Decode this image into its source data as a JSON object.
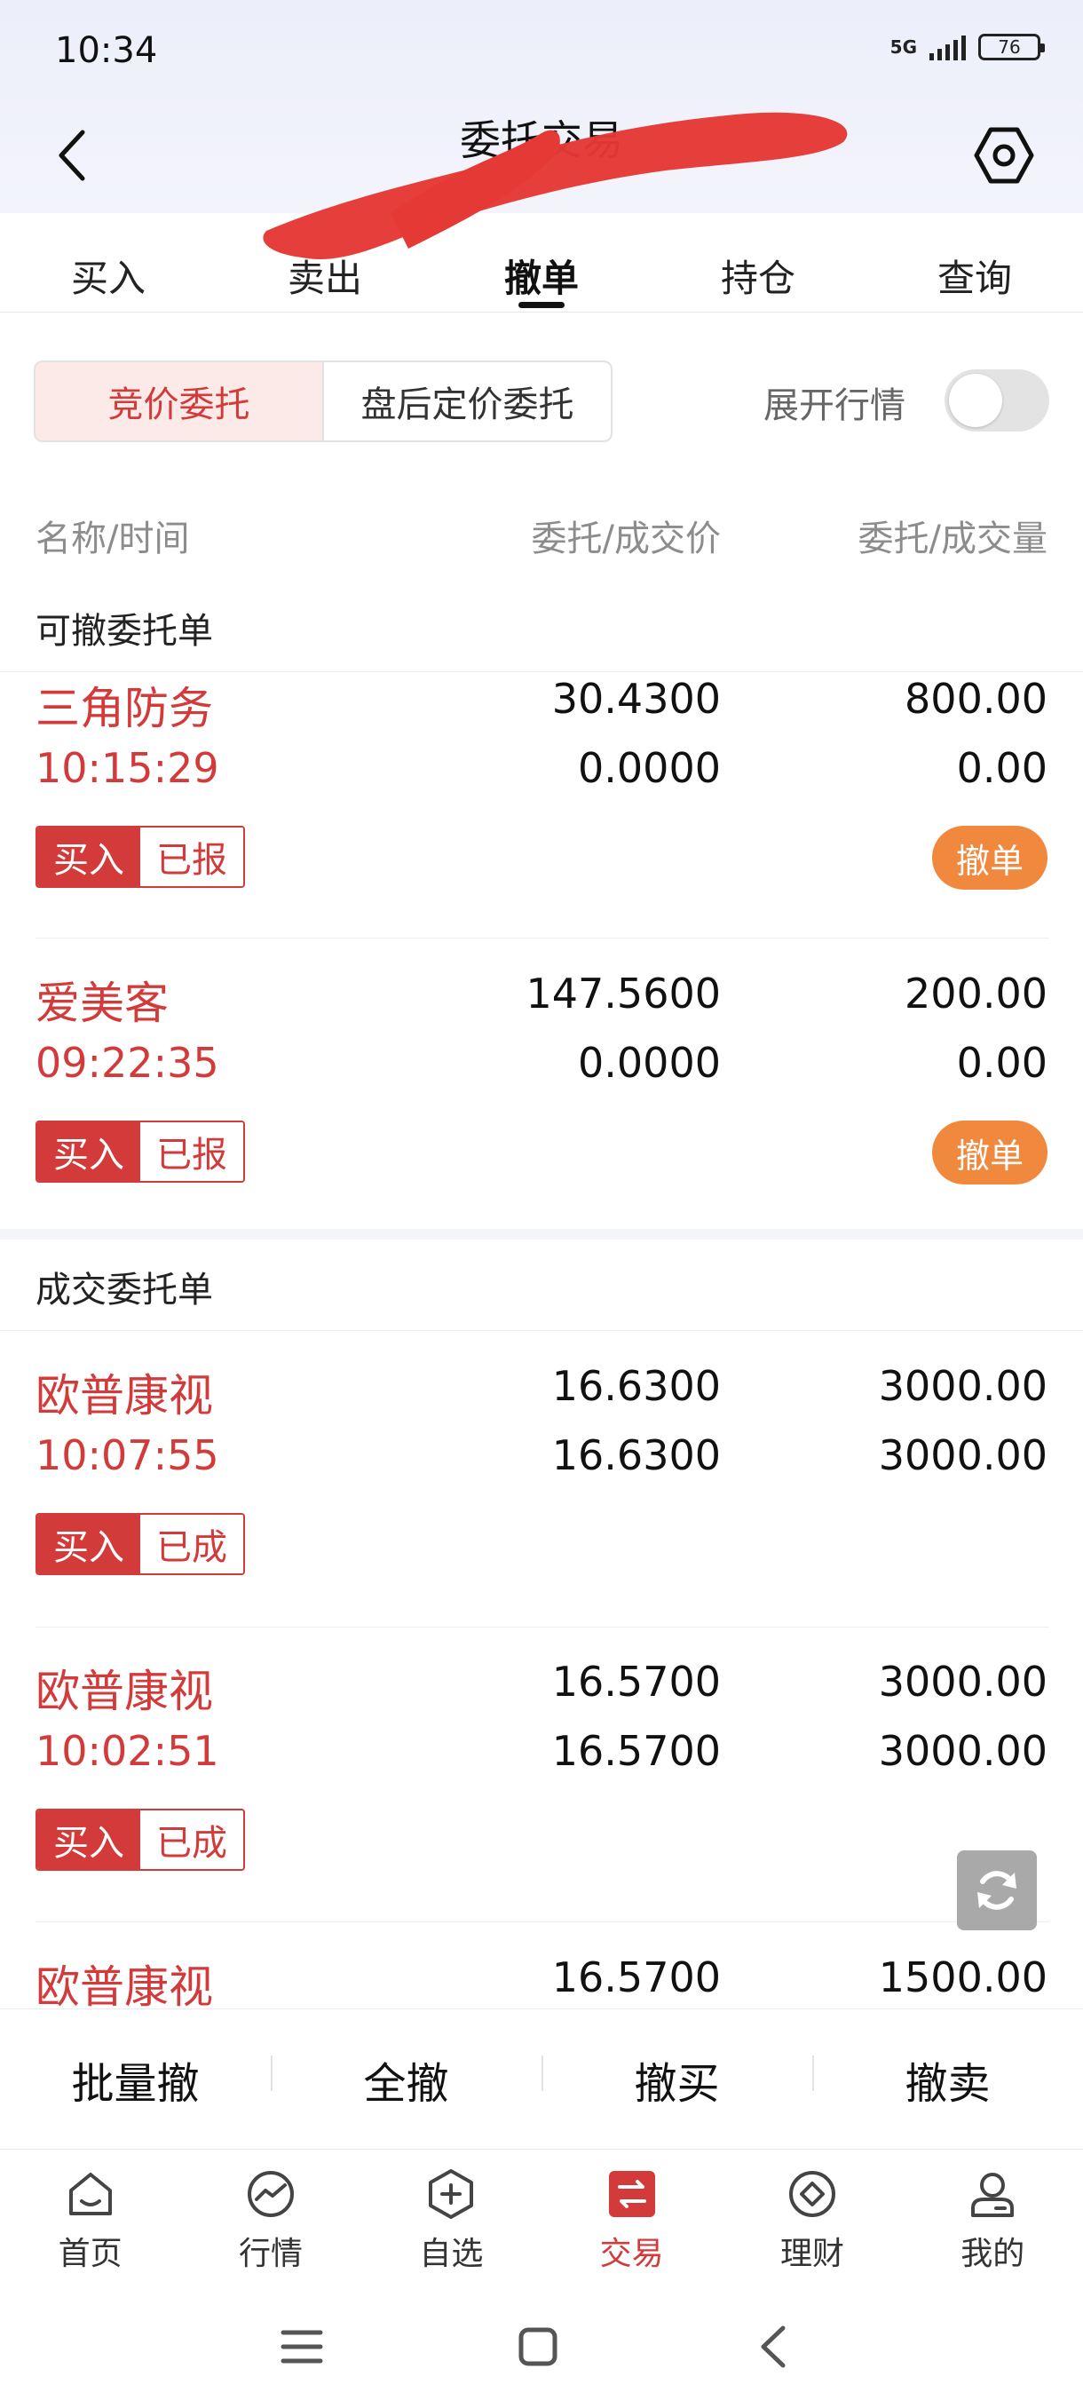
{
  "status_bar": {
    "time": "10:34",
    "network": "5G",
    "battery": "76"
  },
  "header": {
    "title": "委托交易",
    "back_icon": "chevron-left-icon",
    "settings_icon": "settings-hexagon-icon"
  },
  "tabs": [
    {
      "label": "买入"
    },
    {
      "label": "卖出"
    },
    {
      "label": "撤单",
      "active": true
    },
    {
      "label": "持仓"
    },
    {
      "label": "查询"
    }
  ],
  "segments": {
    "active": "竞价委托",
    "other": "盘后定价委托"
  },
  "expand_quote": {
    "label": "展开行情",
    "on": false
  },
  "columns": {
    "name_time": "名称/时间",
    "price": "委托/成交价",
    "volume": "委托/成交量"
  },
  "sections": {
    "cancelable": "可撤委托单",
    "filled": "成交委托单"
  },
  "cancelable_orders": [
    {
      "name": "三角防务",
      "time": "10:15:29",
      "order_price": "30.4300",
      "deal_price": "0.0000",
      "order_qty": "800.00",
      "deal_qty": "0.00",
      "side": "买入",
      "status": "已报",
      "action": "撤单"
    },
    {
      "name": "爱美客",
      "time": "09:22:35",
      "order_price": "147.5600",
      "deal_price": "0.0000",
      "order_qty": "200.00",
      "deal_qty": "0.00",
      "side": "买入",
      "status": "已报",
      "action": "撤单"
    }
  ],
  "filled_orders": [
    {
      "name": "欧普康视",
      "time": "10:07:55",
      "order_price": "16.6300",
      "deal_price": "16.6300",
      "order_qty": "3000.00",
      "deal_qty": "3000.00",
      "side": "买入",
      "status": "已成"
    },
    {
      "name": "欧普康视",
      "time": "10:02:51",
      "order_price": "16.5700",
      "deal_price": "16.5700",
      "order_qty": "3000.00",
      "deal_qty": "3000.00",
      "side": "买入",
      "status": "已成"
    },
    {
      "name": "欧普康视",
      "order_price": "16.5700",
      "order_qty": "1500.00"
    }
  ],
  "actions": [
    "批量撤",
    "全撤",
    "撤买",
    "撤卖"
  ],
  "bottom_nav": [
    {
      "label": "首页",
      "icon": "home-icon"
    },
    {
      "label": "行情",
      "icon": "market-chart-icon"
    },
    {
      "label": "自选",
      "icon": "add-watchlist-icon"
    },
    {
      "label": "交易",
      "icon": "trade-icon",
      "active": true
    },
    {
      "label": "理财",
      "icon": "wealth-icon"
    },
    {
      "label": "我的",
      "icon": "profile-icon"
    }
  ],
  "colors": {
    "accent_red": "#d33a3a",
    "cancel_orange": "#f0883e",
    "redaction": "#e53935"
  }
}
